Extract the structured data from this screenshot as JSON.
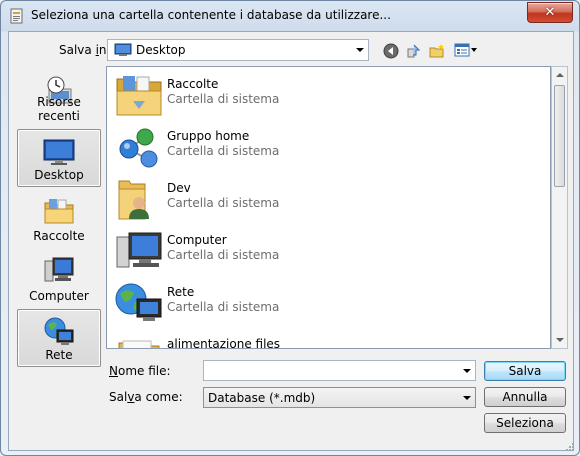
{
  "window": {
    "title": "Seleziona una cartella contenente i database da utilizzare...",
    "close_glyph": "✕"
  },
  "toolbar": {
    "save_in_prefix": "Salva ",
    "save_in_underlined": "i",
    "save_in_suffix": "n:",
    "location": "Desktop",
    "icons": [
      "back-icon",
      "up-folder-icon",
      "new-folder-icon",
      "view-menu-icon"
    ]
  },
  "places": [
    {
      "label": "Risorse recenti",
      "icon": "recent-places-icon",
      "selected": false
    },
    {
      "label": "Desktop",
      "icon": "desktop-icon",
      "selected": true
    },
    {
      "label": "Raccolte",
      "icon": "libraries-icon",
      "selected": false
    },
    {
      "label": "Computer",
      "icon": "computer-icon",
      "selected": false
    },
    {
      "label": "Rete",
      "icon": "network-icon",
      "selected": true
    }
  ],
  "files": [
    {
      "name": "Raccolte",
      "type": "Cartella di sistema",
      "icon": "libraries-folder-icon"
    },
    {
      "name": "Gruppo home",
      "type": "Cartella di sistema",
      "icon": "homegroup-icon"
    },
    {
      "name": "Dev",
      "type": "Cartella di sistema",
      "icon": "user-folder-icon"
    },
    {
      "name": "Computer",
      "type": "Cartella di sistema",
      "icon": "computer-icon"
    },
    {
      "name": "Rete",
      "type": "Cartella di sistema",
      "icon": "network-icon"
    },
    {
      "name": "alimentazione files",
      "type": "",
      "icon": "folder-icon"
    }
  ],
  "form": {
    "filename_prefix": "",
    "filename_underlined": "N",
    "filename_suffix": "ome file:",
    "filename_value": "",
    "savetype_prefix": "Sal",
    "savetype_underlined": "v",
    "savetype_suffix": "a come:",
    "savetype_value": "Database (*.mdb)"
  },
  "buttons": {
    "save": "Salva",
    "cancel": "Annulla",
    "select": "Seleziona"
  }
}
